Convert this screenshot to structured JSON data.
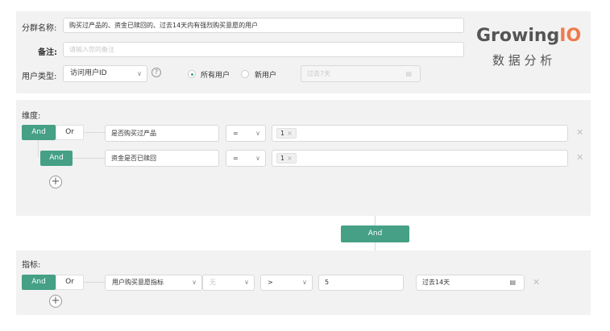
{
  "form": {
    "group_name_label": "分群名称:",
    "group_name_value": "购买过产品的、资金已赎回的、过去14天内有强烈购买意愿的用户",
    "remark_label": "备注:",
    "remark_placeholder": "请输入您的备注",
    "user_type_label": "用户类型:",
    "user_type_select": "访问用户ID",
    "radio_all": "所有用户",
    "radio_new": "新用户",
    "date_placeholder": "过去7天"
  },
  "brand": {
    "name_part1": "Growing",
    "name_part2": "IO",
    "subtitle": "数 据 分 析"
  },
  "dimensions": {
    "title": "维度:",
    "and_label": "And",
    "or_label": "Or",
    "rows": [
      {
        "logic": "And",
        "field": "是否购买过产品",
        "operator": "=",
        "tag": "1"
      },
      {
        "logic": "And",
        "field": "资金是否已赎回",
        "operator": "=",
        "tag": "1"
      }
    ]
  },
  "connector": {
    "label": "And"
  },
  "metrics": {
    "title": "指标:",
    "and_label": "And",
    "or_label": "Or",
    "row": {
      "metric": "用户购买意愿指标",
      "sub": "无",
      "operator": ">",
      "value": "5",
      "date": "过去14天"
    }
  },
  "colors": {
    "accent": "#45a085",
    "brand_orange": "#f07a4b",
    "panel": "#f2f2f2"
  }
}
